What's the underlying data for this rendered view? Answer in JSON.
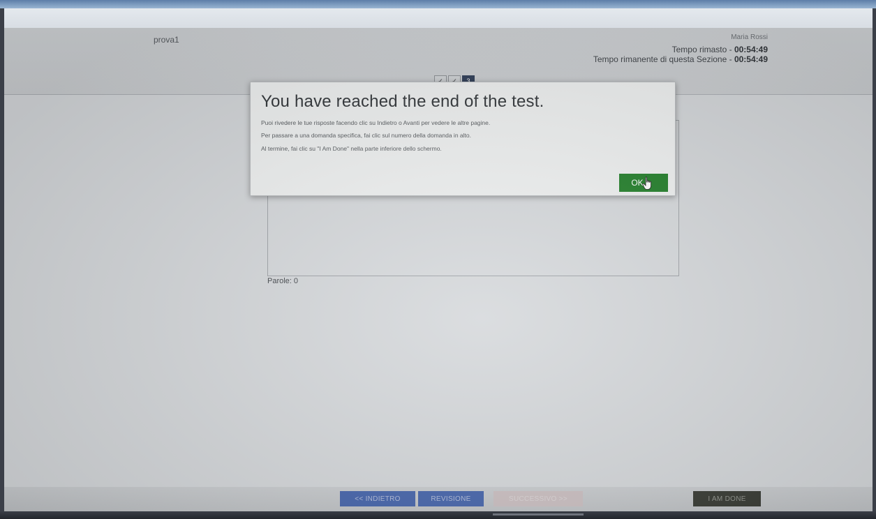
{
  "header": {
    "test_name": "prova1",
    "user_name": "Maria Rossi",
    "timer_total_label": "Tempo rimasto - ",
    "timer_total_value": "00:54:49",
    "timer_section_label": "Tempo rimanente di questa Sezione - ",
    "timer_section_value": "00:54:49"
  },
  "question_nav": [
    {
      "label": "✓"
    },
    {
      "label": "✓"
    },
    {
      "label": "3"
    }
  ],
  "answer": {
    "word_count_label": "Parole: 0"
  },
  "dialog": {
    "title": "You have reached the end of the test.",
    "lines": [
      "Puoi rivedere le tue risposte facendo clic su Indietro o Avanti per vedere le altre pagine.",
      "Per passare a una domanda specifica, fai clic sul numero della domanda in alto.",
      "Al termine, fai clic su \"I Am Done\" nella parte inferiore dello schermo."
    ],
    "ok_label": "OK",
    "ok_color": "#1a7a22"
  },
  "footer": {
    "back_label": "<< INDIETRO",
    "review_label": "REVISIONE",
    "next_label": "SUCCESSIVO >>",
    "done_label": "I AM DONE"
  },
  "colors": {
    "nav_button": "#3f5fa8",
    "done_button": "#33362f",
    "screen_bg": "#d3d6d9"
  }
}
